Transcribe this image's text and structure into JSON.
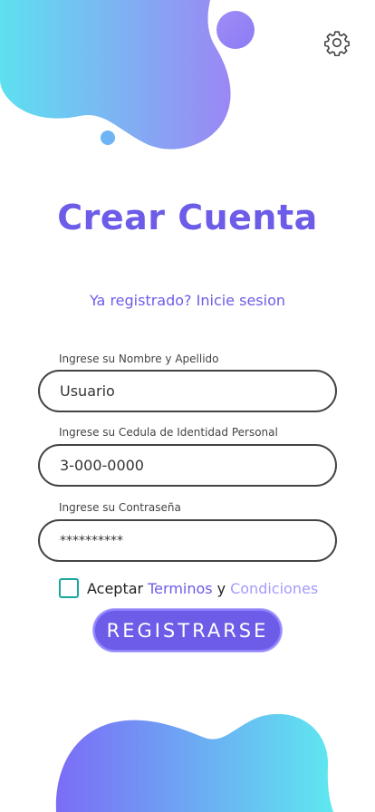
{
  "header": {
    "settings_icon": "gear-icon"
  },
  "main": {
    "title": "Crear Cuenta",
    "login_link": "Ya registrado? Inicie sesion"
  },
  "form": {
    "name": {
      "label": "Ingrese su Nombre y Apellido",
      "value": "Usuario"
    },
    "cedula": {
      "label": "Ingrese su Cedula de Identidad Personal",
      "value": "3-000-0000"
    },
    "password": {
      "label": "Ingrese su Contraseña",
      "value": "**********"
    },
    "terms": {
      "checked": false,
      "prefix": "Aceptar",
      "link_terms": "Terminos",
      "conjunction": "y",
      "link_conditions": "Condiciones"
    },
    "submit_label": "REGISTRARSE"
  },
  "colors": {
    "primary": "#6c5ce7",
    "secondary_link": "#a29bfe",
    "gradient_cyan": "#5ee0f0",
    "gradient_purple": "#7b6cf6",
    "checkbox_border": "#1aa6a0"
  }
}
